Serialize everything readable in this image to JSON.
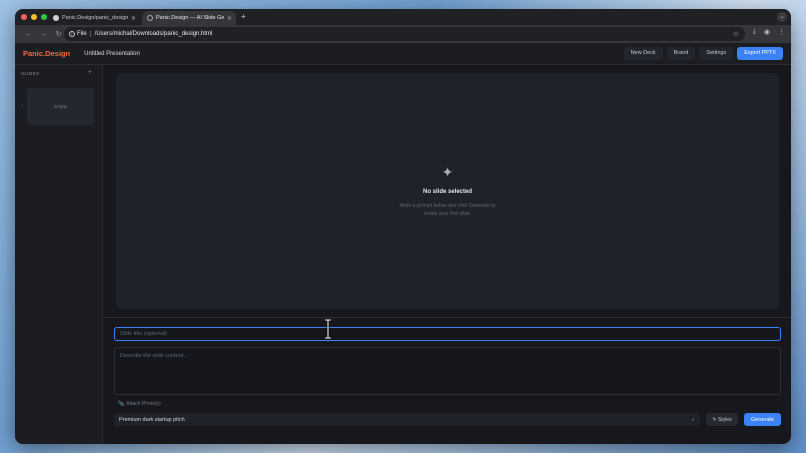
{
  "browser": {
    "tabs": [
      {
        "title": "Panic.Design/panic_design.h",
        "icon": "github-icon"
      },
      {
        "title": "Panic.Design — AI Slide Gene",
        "icon": "globe-icon"
      }
    ],
    "url_chip": "File",
    "url": "/Users/michal/Downloads/panic_design.html"
  },
  "header": {
    "brand": "Panic.Design",
    "presentation_title": "Untitled Presentation",
    "buttons": {
      "new_deck": "New Deck",
      "brand": "Brand",
      "settings": "Settings",
      "export": "Export PPTX"
    }
  },
  "sidebar": {
    "heading": "SLIDES",
    "add_symbol": "+",
    "slides": [
      {
        "number": "1",
        "label": "Empty"
      }
    ]
  },
  "canvas": {
    "empty_title": "No slide selected",
    "empty_desc": "Write a prompt below and click Generate to create your first slide."
  },
  "composer": {
    "title_placeholder": "Slide title (optional)",
    "content_placeholder": "Describe the slide content...",
    "attach_label": "Attach Photo(s)",
    "style_value": "Premium dark startup pitch",
    "styles_label": "✎ Styles",
    "generate_label": "Generate"
  },
  "colors": {
    "accent": "#3b82f6",
    "brand": "#f26a3d"
  }
}
